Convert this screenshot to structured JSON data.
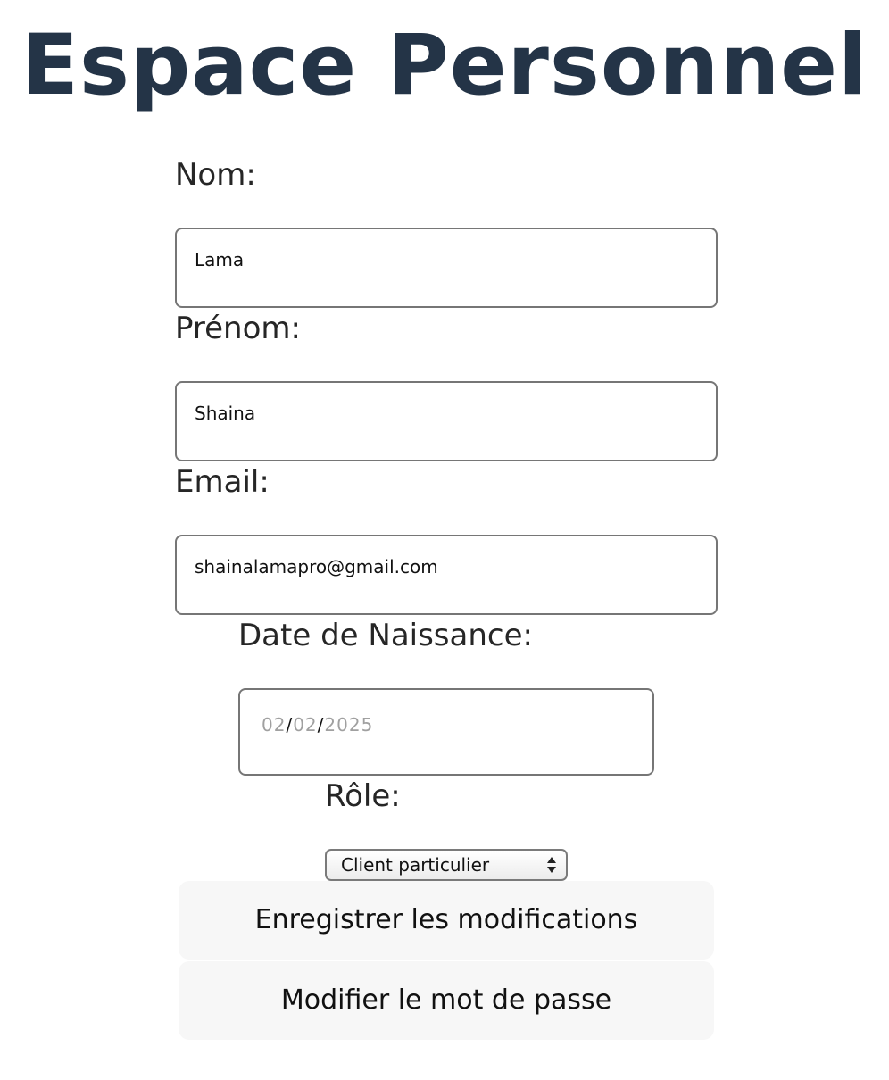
{
  "page": {
    "title": "Espace Personnel"
  },
  "form": {
    "nom": {
      "label": "Nom:",
      "value": "Lama"
    },
    "prenom": {
      "label": "Prénom:",
      "value": "Shaina"
    },
    "email": {
      "label": "Email:",
      "value": "shainalamapro@gmail.com"
    },
    "date_naissance": {
      "label": "Date de Naissance:",
      "day": "02",
      "month": "02",
      "year": "2025",
      "separator": "/"
    },
    "role": {
      "label": "Rôle:",
      "selected": "Client particulier"
    }
  },
  "actions": {
    "save_label": "Enregistrer les modifications",
    "change_password_label": "Modifier le mot de passe"
  },
  "colors": {
    "title": "#243447",
    "text": "#262626",
    "border": "#767676",
    "button_bg": "#f7f7f7",
    "placeholder": "#a0a0a0"
  },
  "icons": {
    "select_arrows": "up-down-chevron-icon"
  }
}
